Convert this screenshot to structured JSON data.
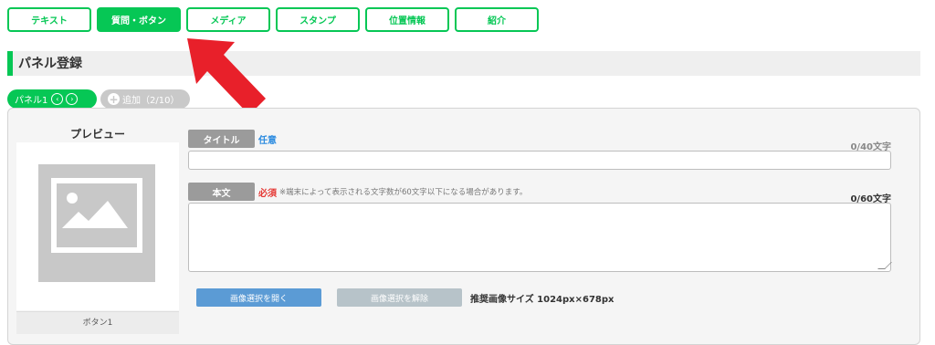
{
  "tabs": [
    {
      "label": "テキスト",
      "active": false
    },
    {
      "label": "質問・ボタン",
      "active": true
    },
    {
      "label": "メディア",
      "active": false
    },
    {
      "label": "スタンプ",
      "active": false
    },
    {
      "label": "位置情報",
      "active": false
    },
    {
      "label": "紹介",
      "active": false
    }
  ],
  "section": {
    "title": "パネル登録"
  },
  "panel_tab": {
    "label": "パネル1"
  },
  "add_tab": {
    "label": "追加（2/10）"
  },
  "preview": {
    "label": "プレビュー",
    "button_label": "ボタン1"
  },
  "title_field": {
    "label": "タイトル",
    "badge": "任意",
    "count": "0/40文字",
    "value": ""
  },
  "body_field": {
    "label": "本文",
    "badge": "必須",
    "note": "※端末によって表示される文字数が60文字以下になる場合があります。",
    "count": "0/60文字",
    "value": ""
  },
  "image": {
    "open_label": "画像選択を開く",
    "clear_label": "画像選択を解除",
    "recommended": "推奨画像サイズ 1024px×678px"
  },
  "colors": {
    "accent": "#06c755",
    "arrow": "#e8202a",
    "open_button": "#5b9bd5",
    "clear_button": "#b7c3c9"
  }
}
